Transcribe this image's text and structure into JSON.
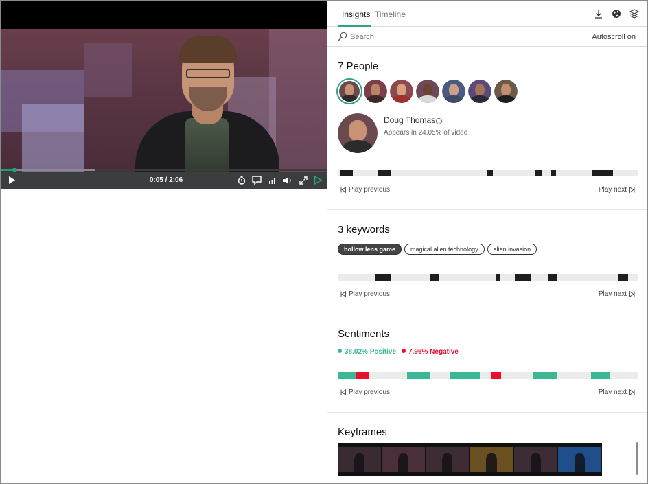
{
  "player": {
    "time": "0:05 / 2:06",
    "progress_fraction": 0.04,
    "buffer_fraction": 0.29,
    "controls": [
      "play-icon",
      "playback-speed-icon",
      "captions-icon",
      "quality-icon",
      "volume-icon",
      "fullscreen-icon",
      "insights-toggle-icon"
    ]
  },
  "tabs": [
    {
      "label": "Insights",
      "active": true
    },
    {
      "label": "Timeline",
      "active": false
    }
  ],
  "header_icons": [
    "download-icon",
    "globe-icon",
    "layers-icon"
  ],
  "search": {
    "placeholder": "Search",
    "autoscroll": "Autoscroll on"
  },
  "people": {
    "title": "7 People",
    "selected": {
      "name": "Doug Thomas",
      "info_icon": "ⓘ",
      "appears": "Appears in 24.05% of video"
    },
    "avatars": [
      {
        "name": "person-1",
        "skin": "#c99274",
        "shirt": "#2b2b2b",
        "bg": "#6b4a4f",
        "selected": true
      },
      {
        "name": "person-2",
        "skin": "#b98466",
        "shirt": "#3a2a2a",
        "bg": "#7a3f48"
      },
      {
        "name": "person-3",
        "skin": "#d7a07e",
        "shirt": "#a03030",
        "bg": "#8a4a50"
      },
      {
        "name": "person-4",
        "skin": "#6a4431",
        "shirt": "#d9d9d9",
        "bg": "#6e4a58"
      },
      {
        "name": "person-5",
        "skin": "#caa08a",
        "shirt": "#3e4a6a",
        "bg": "#4a5a80"
      },
      {
        "name": "person-6",
        "skin": "#a57356",
        "shirt": "#2a2a3a",
        "bg": "#5a4a7a"
      },
      {
        "name": "person-7",
        "skin": "#c38d70",
        "shirt": "#1f1f1f",
        "bg": "#6a5a4a"
      }
    ],
    "timeline_segments": [
      [
        0.01,
        0.05
      ],
      [
        0.135,
        0.175
      ],
      [
        0.495,
        0.515
      ],
      [
        0.655,
        0.68
      ],
      [
        0.708,
        0.727
      ],
      [
        0.845,
        0.915
      ]
    ],
    "play_previous": "Play previous",
    "play_next": "Play next"
  },
  "keywords": {
    "title": "3 keywords",
    "chips": [
      {
        "label": "hollow lens game",
        "active": true
      },
      {
        "label": "magical alien technology",
        "active": false
      },
      {
        "label": "alien invasion",
        "active": false
      }
    ],
    "timeline_segments": [
      [
        0.125,
        0.178
      ],
      [
        0.305,
        0.335
      ],
      [
        0.525,
        0.542
      ],
      [
        0.588,
        0.645
      ],
      [
        0.7,
        0.73
      ],
      [
        0.933,
        0.965
      ]
    ],
    "play_previous": "Play previous",
    "play_next": "Play next"
  },
  "sentiments": {
    "title": "Sentiments",
    "positive": {
      "label": "38.02% Positive",
      "color": "#3ab794"
    },
    "negative": {
      "label": "7.96% Negative",
      "color": "#e8112d"
    },
    "segments": [
      {
        "range": [
          0.0,
          0.06
        ],
        "type": "positive"
      },
      {
        "range": [
          0.06,
          0.105
        ],
        "type": "negative"
      },
      {
        "range": [
          0.23,
          0.305
        ],
        "type": "positive"
      },
      {
        "range": [
          0.375,
          0.472
        ],
        "type": "positive"
      },
      {
        "range": [
          0.508,
          0.543
        ],
        "type": "negative"
      },
      {
        "range": [
          0.648,
          0.73
        ],
        "type": "positive"
      },
      {
        "range": [
          0.843,
          0.907
        ],
        "type": "positive"
      }
    ],
    "play_previous": "Play previous",
    "play_next": "Play next"
  },
  "keyframes": {
    "title": "Keyframes",
    "frames": [
      {
        "bg": "#3a2a32"
      },
      {
        "bg": "#4a2f3b"
      },
      {
        "bg": "#3d2c34"
      },
      {
        "bg": "#6a5020"
      },
      {
        "bg": "#3b2c36"
      },
      {
        "bg": "#1f4e8a"
      }
    ]
  },
  "colors": {
    "accent": "#2ba384",
    "dark_segment": "#1e1e1e"
  }
}
